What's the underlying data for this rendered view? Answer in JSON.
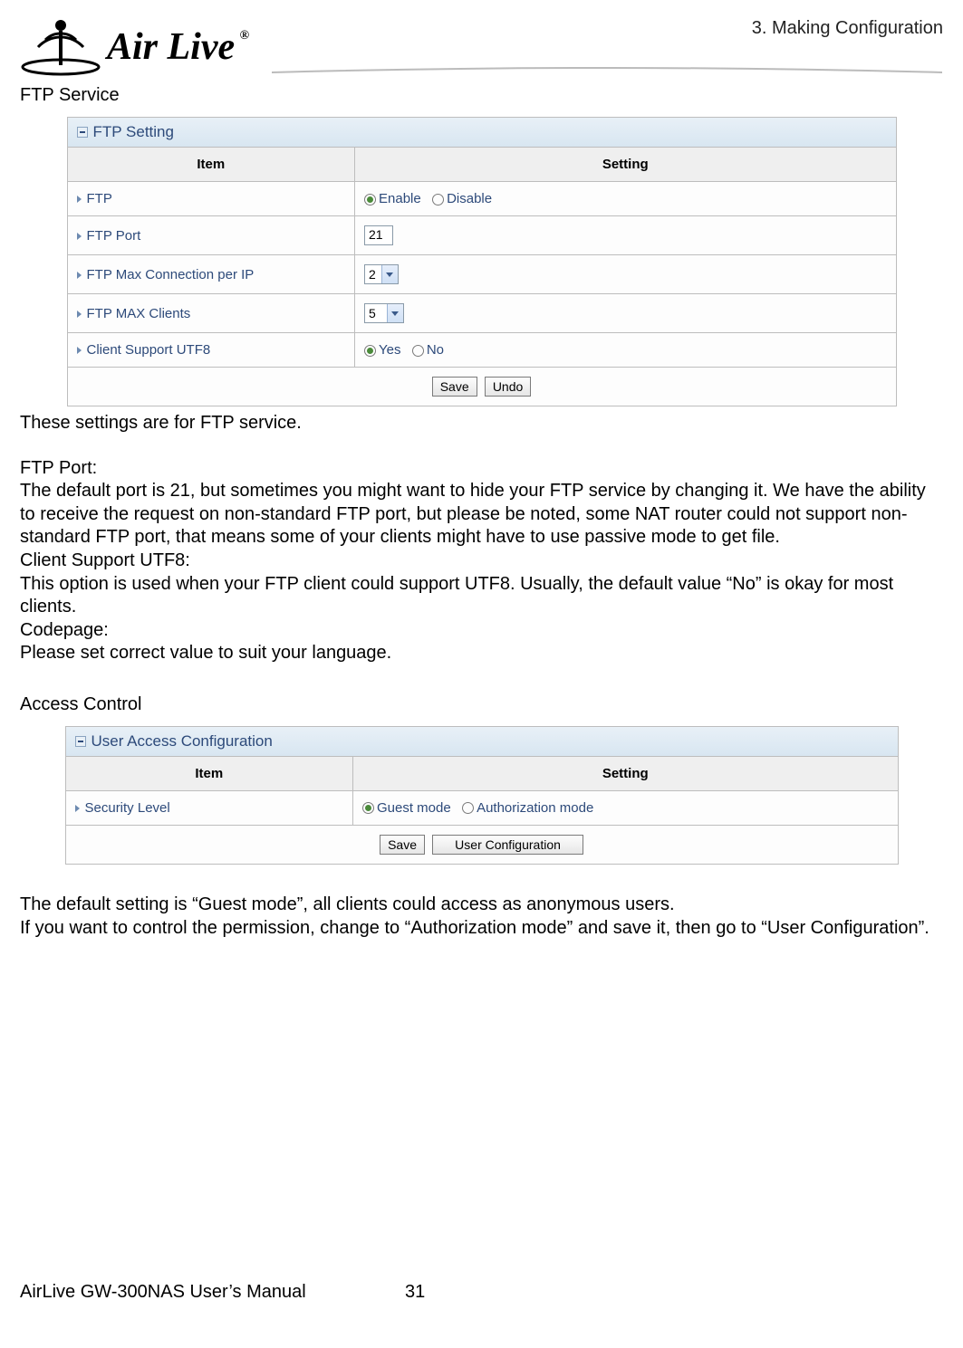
{
  "header": {
    "chapter": "3. Making Configuration",
    "logo_text": "Air Live",
    "reg_mark": "®"
  },
  "section1": {
    "title": "FTP Service",
    "panel_title": "FTP Setting",
    "columns": {
      "item": "Item",
      "setting": "Setting"
    },
    "rows": {
      "ftp": {
        "label": "FTP",
        "enable": "Enable",
        "disable": "Disable"
      },
      "port": {
        "label": "FTP Port",
        "value": "21"
      },
      "maxconn": {
        "label": "FTP Max Connection per IP",
        "value": "2"
      },
      "maxclients": {
        "label": "FTP MAX Clients",
        "value": "5"
      },
      "utf8": {
        "label": "Client Support UTF8",
        "yes": "Yes",
        "no": "No"
      }
    },
    "buttons": {
      "save": "Save",
      "undo": "Undo"
    },
    "body": {
      "l1": "These settings are for FTP service.",
      "l2": "FTP Port:",
      "l3": "The default port is 21, but sometimes you might want to hide your FTP service by changing it. We have the ability to receive the request on non-standard FTP port, but please be noted, some NAT router could not support non-standard FTP port, that means some of your clients might have to use passive mode to get file.",
      "l4": "Client Support UTF8:",
      "l5": "This option is used when your FTP client could support UTF8. Usually, the default value “No” is okay for most clients.",
      "l6": "Codepage:",
      "l7": "Please set correct value to suit your language."
    }
  },
  "section2": {
    "title": "Access Control",
    "panel_title": "User Access Configuration",
    "columns": {
      "item": "Item",
      "setting": "Setting"
    },
    "rows": {
      "security": {
        "label": "Security Level",
        "guest": "Guest mode",
        "auth": "Authorization mode"
      }
    },
    "buttons": {
      "save": "Save",
      "userconfig": "User Configuration"
    },
    "body": {
      "l1": "The default setting is “Guest mode”, all clients could access as anonymous users.",
      "l2": "If you want to control the permission, change to “Authorization mode” and save it, then go to “User Configuration”."
    }
  },
  "footer": {
    "manual": "AirLive GW-300NAS User’s Manual",
    "page": "31"
  }
}
